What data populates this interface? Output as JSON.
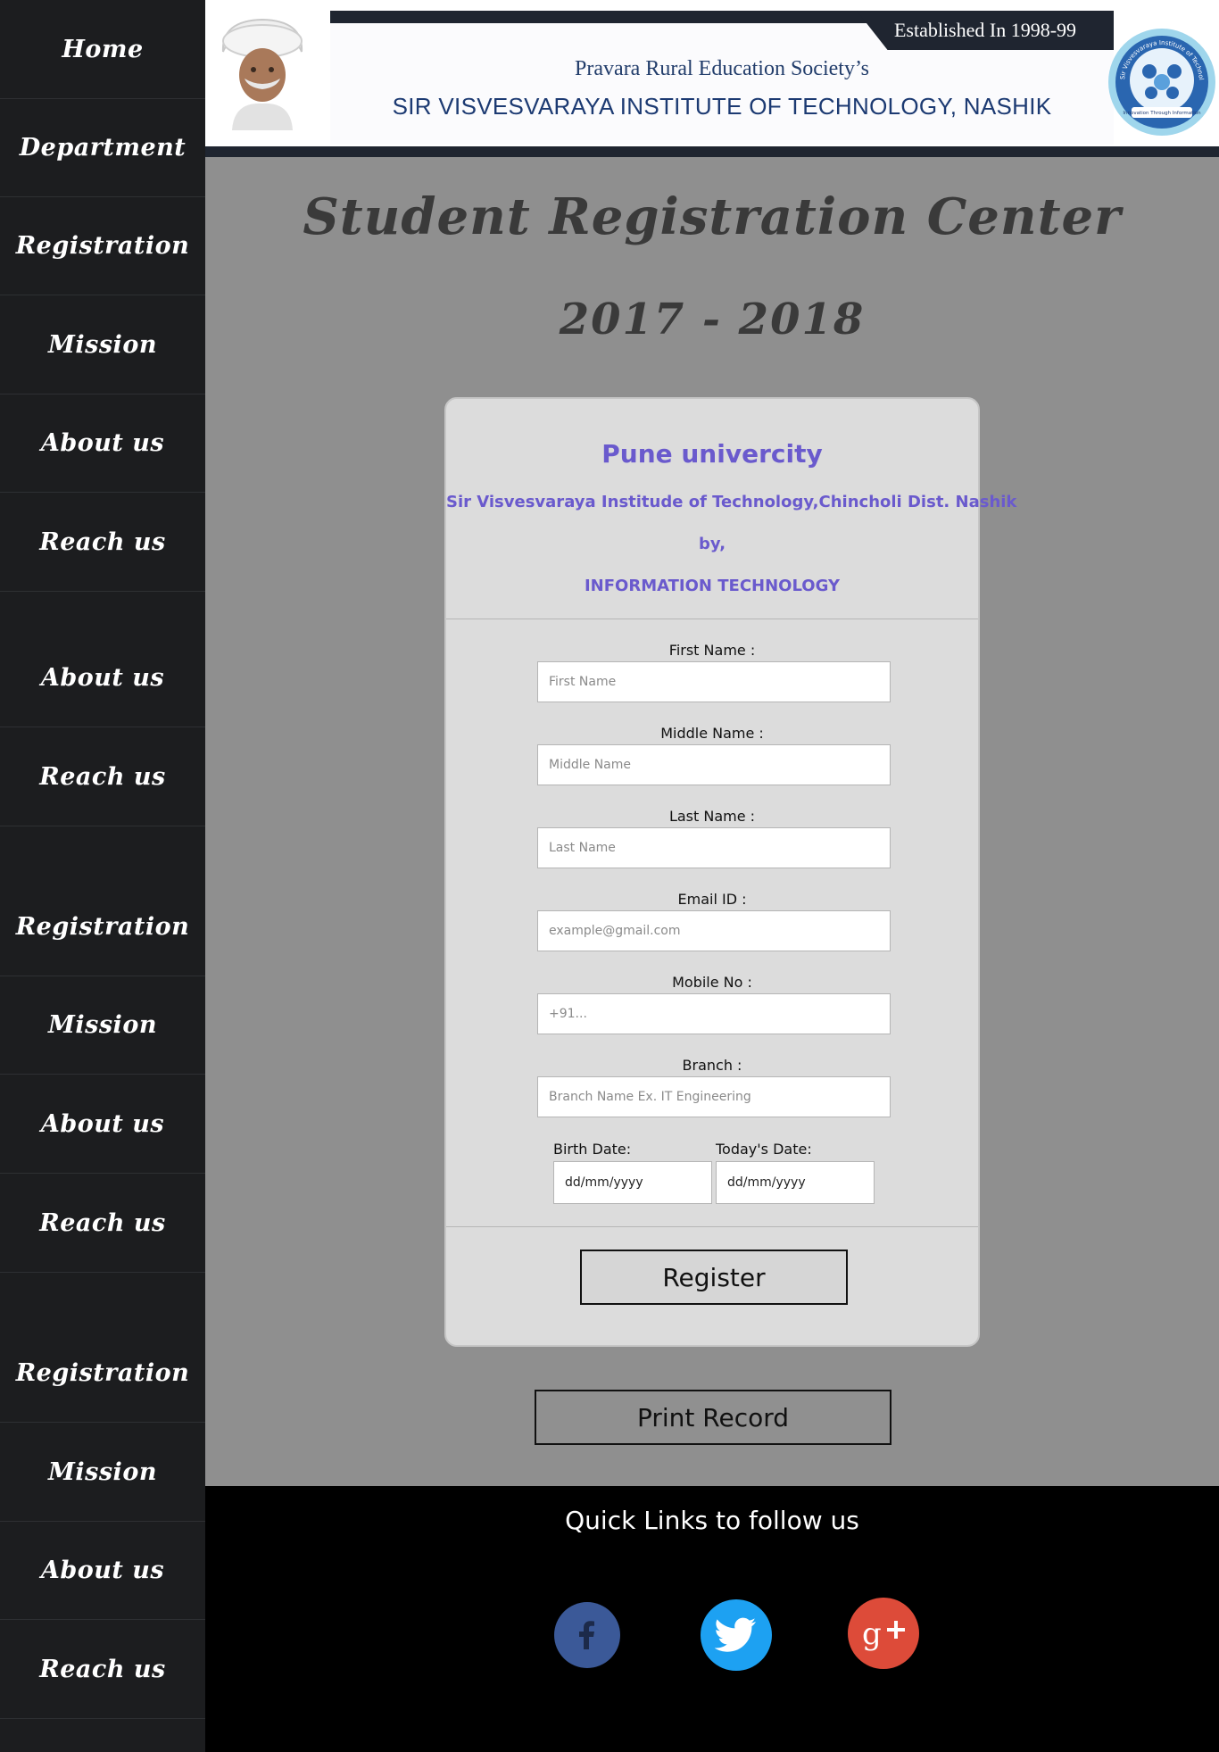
{
  "sidebar": {
    "items": [
      {
        "label": "Home"
      },
      {
        "label": "Department"
      },
      {
        "label": "Registration"
      },
      {
        "label": "Mission"
      },
      {
        "label": "About us"
      },
      {
        "label": "Reach us"
      },
      {
        "label": "About us"
      },
      {
        "label": "Reach us"
      },
      {
        "label": "Registration"
      },
      {
        "label": "Mission"
      },
      {
        "label": "About us"
      },
      {
        "label": "Reach us"
      },
      {
        "label": "Registration"
      },
      {
        "label": "Mission"
      },
      {
        "label": "About us"
      },
      {
        "label": "Reach us"
      }
    ]
  },
  "header": {
    "established": "Established In 1998-99",
    "society": "Pravara Rural Education Society’s",
    "institute": "SIR VISVESVARAYA INSTITUTE OF TECHNOLOGY, NASHIK",
    "logo_ring_text": "Sir Visvesvaraya Institute of Technology",
    "logo_motto": "Innovation Through Information"
  },
  "main": {
    "title": "Student Registration Center",
    "year": "2017 - 2018"
  },
  "form": {
    "university": "Pune univercity",
    "institute": "Sir Visvesvaraya Institude of Technology,Chincholi Dist. Nashik",
    "by": "by,",
    "department": "INFORMATION TECHNOLOGY",
    "fields": [
      {
        "label": "First Name :",
        "placeholder": "First Name"
      },
      {
        "label": "Middle Name :",
        "placeholder": "Middle Name"
      },
      {
        "label": "Last Name :",
        "placeholder": "Last Name"
      },
      {
        "label": "Email ID :",
        "placeholder": "example@gmail.com"
      },
      {
        "label": "Mobile No :",
        "placeholder": "+91..."
      },
      {
        "label": "Branch :",
        "placeholder": "Branch Name Ex. IT Engineering"
      }
    ],
    "birth_date": {
      "label": "Birth Date:",
      "value": "dd/mm/yyyy"
    },
    "today_date": {
      "label": "Today's Date:",
      "value": "dd/mm/yyyy"
    },
    "register_label": "Register"
  },
  "print_label": "Print Record",
  "footer": {
    "title": "Quick Links to follow us"
  },
  "colors": {
    "form_heading": "#6a5acd",
    "facebook": "#3b5998",
    "twitter": "#1da1f2",
    "googleplus": "#dd4b39"
  }
}
